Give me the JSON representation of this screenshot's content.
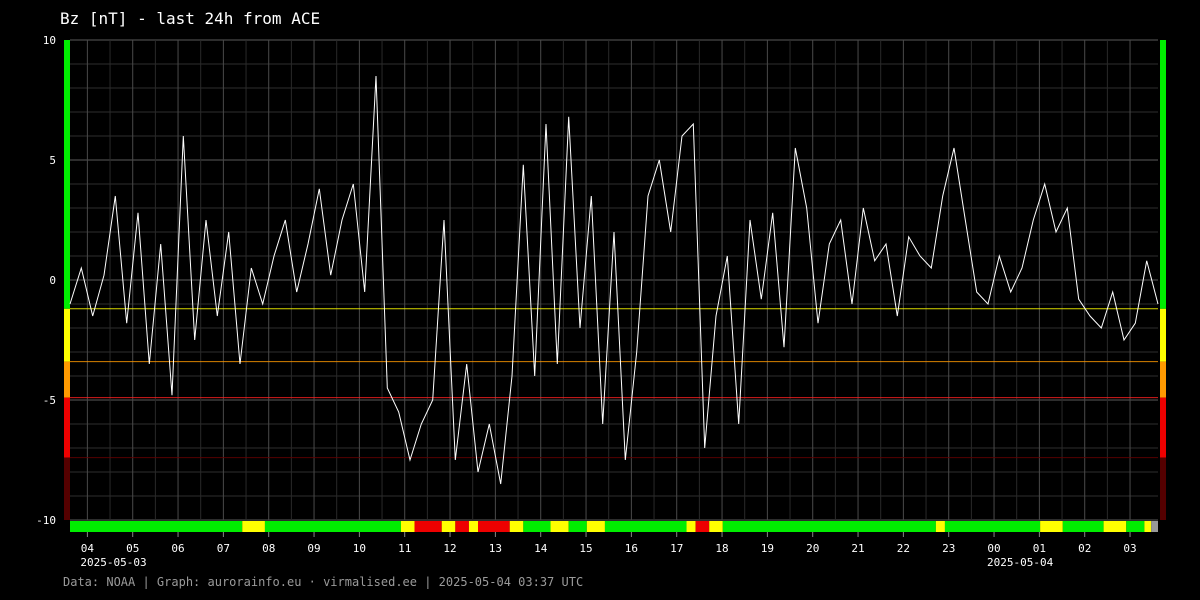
{
  "title": "Bz [nT] - last 24h from ACE",
  "footer": "Data: NOAA | Graph: aurorainfo.eu · virmalised.ee | 2025-05-04 03:37 UTC",
  "chart_data": {
    "type": "line",
    "title": "Bz [nT] - last 24h from ACE",
    "ylim": [
      -10,
      10
    ],
    "yticks": [
      "10",
      "5",
      "0",
      "-5",
      "-10"
    ],
    "xlim": [
      "2025-05-03 03:37",
      "2025-05-04 03:37"
    ],
    "xticks": [
      "04",
      "05",
      "06",
      "07",
      "08",
      "09",
      "10",
      "11",
      "12",
      "13",
      "14",
      "15",
      "16",
      "17",
      "18",
      "19",
      "20",
      "21",
      "22",
      "23",
      "00",
      "01",
      "02",
      "03"
    ],
    "date_labels": [
      {
        "hour": "04",
        "label": "2025-05-03"
      },
      {
        "hour": "00",
        "label": "2025-05-04"
      }
    ],
    "grid": true,
    "threshold_lines": [
      {
        "y": -1.2,
        "color": "#ffff00"
      },
      {
        "y": -3.4,
        "color": "#ff9900"
      },
      {
        "y": -4.9,
        "color": "#ff2222"
      },
      {
        "y": -7.4,
        "color": "#660000"
      }
    ],
    "colors": {
      "line": "#ffffff",
      "green": "#00ee00",
      "yellow": "#ffff00",
      "orange": "#ff9900",
      "red": "#ee0000",
      "darkred": "#550000",
      "gray": "#999999"
    },
    "series": [
      {
        "hours": [
          0,
          0.25,
          0.5,
          0.75,
          1,
          1.25,
          1.5,
          1.75,
          2,
          2.25,
          2.5,
          2.75,
          3,
          3.25,
          3.5,
          3.75,
          4,
          4.25,
          4.5,
          4.75,
          5,
          5.25,
          5.5,
          5.75,
          6,
          6.25,
          6.5,
          6.75,
          7,
          7.25,
          7.5,
          7.75,
          8,
          8.25,
          8.5,
          8.75,
          9,
          9.25,
          9.5,
          9.75,
          10,
          10.25,
          10.5,
          10.75,
          11,
          11.25,
          11.5,
          11.75,
          12,
          12.25,
          12.5,
          12.75,
          13,
          13.25,
          13.5,
          13.75,
          14,
          14.25,
          14.5,
          14.75,
          15,
          15.25,
          15.5,
          15.75,
          16,
          16.25,
          16.5,
          16.75,
          17,
          17.25,
          17.5,
          17.75,
          18,
          18.25,
          18.5,
          18.75,
          19,
          19.25,
          19.5,
          19.75,
          20,
          20.25,
          20.5,
          20.75,
          21,
          21.25,
          21.5,
          21.75,
          22,
          22.25,
          22.5,
          22.75,
          23,
          23.25,
          23.5,
          23.75,
          24
        ],
        "values": [
          -1.0,
          0.5,
          -1.5,
          0.2,
          3.5,
          -1.8,
          2.8,
          -3.5,
          1.5,
          -4.8,
          6.0,
          -2.5,
          2.5,
          -1.5,
          2.0,
          -3.5,
          0.5,
          -1.0,
          1.0,
          2.5,
          -0.5,
          1.5,
          3.8,
          0.2,
          2.5,
          4.0,
          -0.5,
          8.5,
          -4.5,
          -5.5,
          -7.5,
          -6.0,
          -5.0,
          2.5,
          -7.5,
          -3.5,
          -8.0,
          -6.0,
          -8.5,
          -4.0,
          4.8,
          -4.0,
          6.5,
          -3.5,
          6.8,
          -2.0,
          3.5,
          -6.0,
          2.0,
          -7.5,
          -3.0,
          3.5,
          5.0,
          2.0,
          6.0,
          6.5,
          -7.0,
          -1.5,
          1.0,
          -6.0,
          2.5,
          -0.8,
          2.8,
          -2.8,
          5.5,
          3.0,
          -1.8,
          1.5,
          2.5,
          -1.0,
          3.0,
          0.8,
          1.5,
          -1.5,
          1.8,
          1.0,
          0.5,
          3.5,
          5.5,
          2.5,
          -0.5,
          -1.0,
          1.0,
          -0.5,
          0.5,
          2.5,
          4.0,
          2.0,
          3.0,
          -0.8,
          -1.5,
          -2.0,
          -0.5,
          -2.5,
          -1.8,
          0.8,
          -1.0,
          -2.2,
          -0.8,
          -2.5,
          -1.0,
          2.0,
          -2.5,
          1.2,
          0.5,
          -0.5,
          -2.5,
          5.5,
          5.5
        ]
      }
    ],
    "status_bar": [
      {
        "from": 0,
        "to": 3.8,
        "level": "green"
      },
      {
        "from": 3.8,
        "to": 4.3,
        "level": "yellow"
      },
      {
        "from": 4.3,
        "to": 7.3,
        "level": "green"
      },
      {
        "from": 7.3,
        "to": 7.6,
        "level": "yellow"
      },
      {
        "from": 7.6,
        "to": 8.2,
        "level": "red"
      },
      {
        "from": 8.2,
        "to": 8.5,
        "level": "yellow"
      },
      {
        "from": 8.5,
        "to": 8.8,
        "level": "red"
      },
      {
        "from": 8.8,
        "to": 9.0,
        "level": "yellow"
      },
      {
        "from": 9.0,
        "to": 9.7,
        "level": "red"
      },
      {
        "from": 9.7,
        "to": 10.0,
        "level": "yellow"
      },
      {
        "from": 10.0,
        "to": 10.6,
        "level": "green"
      },
      {
        "from": 10.6,
        "to": 11.0,
        "level": "yellow"
      },
      {
        "from": 11.0,
        "to": 11.4,
        "level": "green"
      },
      {
        "from": 11.4,
        "to": 11.8,
        "level": "yellow"
      },
      {
        "from": 11.8,
        "to": 13.6,
        "level": "green"
      },
      {
        "from": 13.6,
        "to": 13.8,
        "level": "yellow"
      },
      {
        "from": 13.8,
        "to": 14.1,
        "level": "red"
      },
      {
        "from": 14.1,
        "to": 14.4,
        "level": "yellow"
      },
      {
        "from": 14.4,
        "to": 19.1,
        "level": "green"
      },
      {
        "from": 19.1,
        "to": 19.3,
        "level": "yellow"
      },
      {
        "from": 19.3,
        "to": 21.4,
        "level": "green"
      },
      {
        "from": 21.4,
        "to": 21.9,
        "level": "yellow"
      },
      {
        "from": 21.9,
        "to": 22.8,
        "level": "green"
      },
      {
        "from": 22.8,
        "to": 23.3,
        "level": "yellow"
      },
      {
        "from": 23.3,
        "to": 23.7,
        "level": "green"
      },
      {
        "from": 23.7,
        "to": 23.85,
        "level": "yellow"
      },
      {
        "from": 23.85,
        "to": 24.0,
        "level": "gray"
      }
    ],
    "side_bar": [
      {
        "from": -1.2,
        "to": 10,
        "level": "green"
      },
      {
        "from": -3.4,
        "to": -1.2,
        "level": "yellow"
      },
      {
        "from": -4.9,
        "to": -3.4,
        "level": "orange"
      },
      {
        "from": -7.4,
        "to": -4.9,
        "level": "red"
      },
      {
        "from": -10,
        "to": -7.4,
        "level": "darkred"
      }
    ]
  }
}
